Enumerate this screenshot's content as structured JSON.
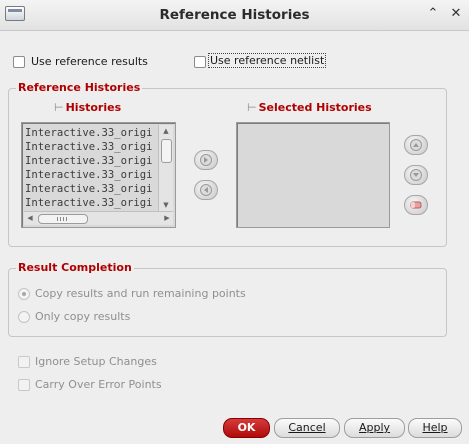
{
  "window": {
    "title": "Reference Histories"
  },
  "options": {
    "use_reference_results": "Use reference results",
    "use_reference_netlist": "Use reference netlist"
  },
  "reference_histories": {
    "group_title": "Reference Histories",
    "histories_header": "Histories",
    "selected_header": "Selected Histories",
    "histories_items": [
      "Interactive.33_origi",
      "Interactive.33_origi",
      "Interactive.33_origi",
      "Interactive.33_origi",
      "Interactive.33_origi",
      "Interactive.33_origi"
    ],
    "selected_items": []
  },
  "result_completion": {
    "group_title": "Result Completion",
    "option_copy_and_run": "Copy results and run remaining points",
    "option_copy_only": "Only copy results",
    "selected": "Copy results and run remaining points"
  },
  "extra_options": {
    "ignore_setup_changes": "Ignore Setup Changes",
    "carry_over_error_points": "Carry Over Error Points"
  },
  "buttons": {
    "ok": "OK",
    "cancel": "Cancel",
    "apply": "Apply",
    "help": "Help"
  },
  "colors": {
    "section_title": "#b00000",
    "ok_button": "#c41e1e",
    "window_bg": "#eeeeee"
  }
}
